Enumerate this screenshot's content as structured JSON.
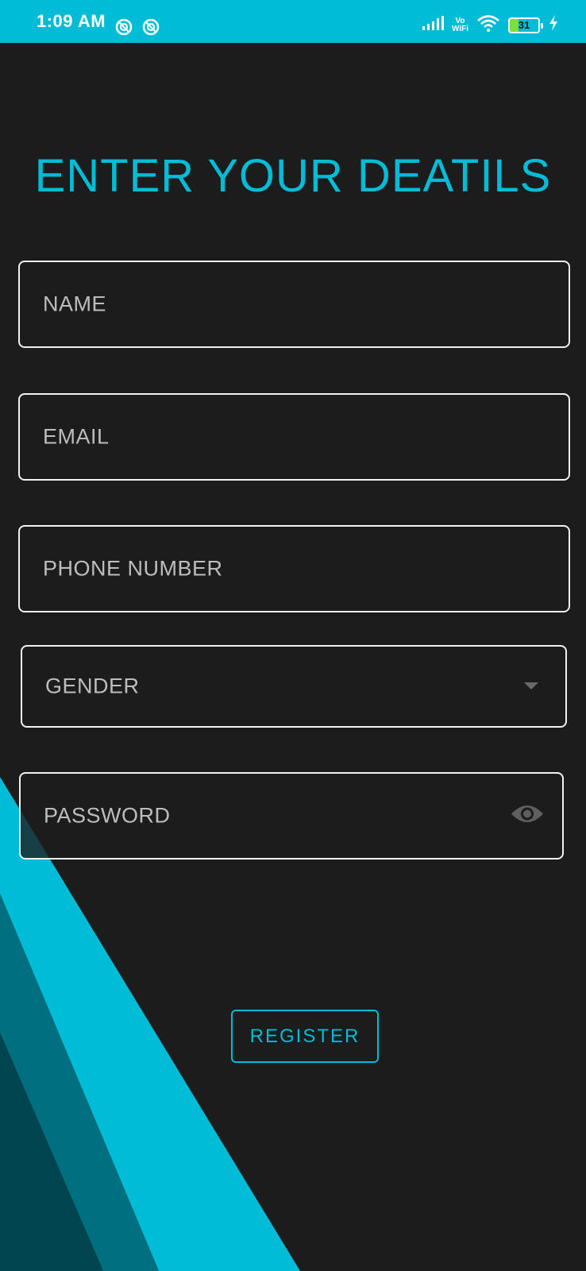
{
  "status_bar": {
    "time": "1:09 AM",
    "vo_label": "Vo",
    "wifi_label": "WiFi",
    "battery": "31",
    "icons": [
      "notification-icon",
      "notification-icon",
      "signal-icon",
      "vowifi-icon",
      "wifi-icon",
      "battery-icon",
      "charging-icon"
    ]
  },
  "title": "ENTER YOUR DEATILS",
  "form": {
    "name_placeholder": "NAME",
    "email_placeholder": "EMAIL",
    "phone_placeholder": "PHONE NUMBER",
    "gender_placeholder": "GENDER",
    "password_placeholder": "PASSWORD",
    "register_label": "REGISTER"
  },
  "colors": {
    "accent": "#00bcd6",
    "background": "#1c1c1d",
    "stripe_mid": "#006f7f",
    "stripe_dark": "#00454f",
    "field_border": "#f1f1f1",
    "placeholder_text": "#bdbdbd"
  }
}
